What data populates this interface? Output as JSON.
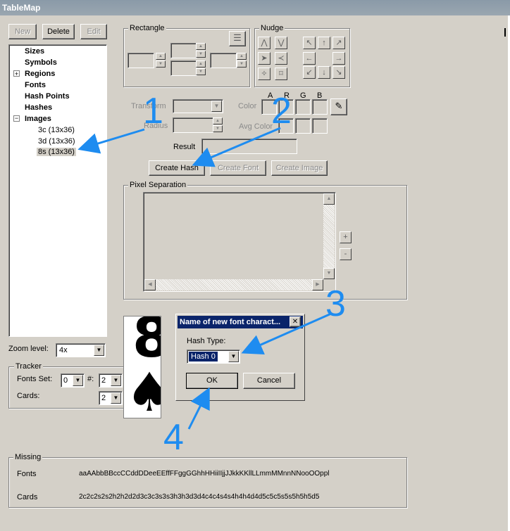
{
  "window": {
    "title": "TableMap"
  },
  "toolbar": {
    "new_label": "New",
    "delete_label": "Delete",
    "edit_label": "Edit"
  },
  "tree": {
    "items": [
      "Sizes",
      "Symbols",
      "Regions",
      "Fonts",
      "Hash Points",
      "Hashes",
      "Images"
    ],
    "images_children": [
      "3c (13x36)",
      "3d (13x36)",
      "8s (13x36)"
    ],
    "selected": "8s (13x36)"
  },
  "zoom": {
    "label": "Zoom level:",
    "value": "4x"
  },
  "tracker": {
    "label": "Tracker",
    "fonts_set_label": "Fonts Set:",
    "fonts_set_value": "0",
    "hash_label": "#:",
    "hash_value": "2",
    "cards_label": "Cards:",
    "cards_value": "2"
  },
  "rectangle": {
    "label": "Rectangle"
  },
  "nudge": {
    "label": "Nudge"
  },
  "form": {
    "transform_label": "Transform",
    "radius_label": "Radius",
    "color_label": "Color",
    "avg_color_label": "Avg Color",
    "result_label": "Result",
    "col_a": "A",
    "col_r": "R",
    "col_g": "G",
    "col_b": "B",
    "create_hash_label": "Create Hash",
    "create_font_label": "Create Font",
    "create_image_label": "Create Image"
  },
  "pixel_separation": {
    "label": "Pixel Separation",
    "plus": "+",
    "minus": "-"
  },
  "preview": {
    "glyph_rank": "8",
    "glyph_suit": "♠"
  },
  "dialog": {
    "title": "Name of new font charact...",
    "close": "✕",
    "hash_type_label": "Hash Type:",
    "hash_type_value": "Hash 0",
    "ok_label": "OK",
    "cancel_label": "Cancel"
  },
  "missing": {
    "label": "Missing",
    "fonts_label": "Fonts",
    "fonts_value": "aaAAbbBBccCCddDDeeEEffFFggGGhhHHiiIIjjJJkkKKllLLmmMMnnNNooOOppl",
    "cards_label": "Cards",
    "cards_value": "2c2c2s2s2h2h2d2d3c3c3s3s3h3h3d3d4c4c4s4s4h4h4d4d5c5c5s5s5h5h5d5"
  },
  "annotations": [
    "1",
    "2",
    "3",
    "4"
  ],
  "colors": {
    "annotation": "#1e8cf0",
    "selection": "#0a246a",
    "face": "#d4d0c8"
  }
}
